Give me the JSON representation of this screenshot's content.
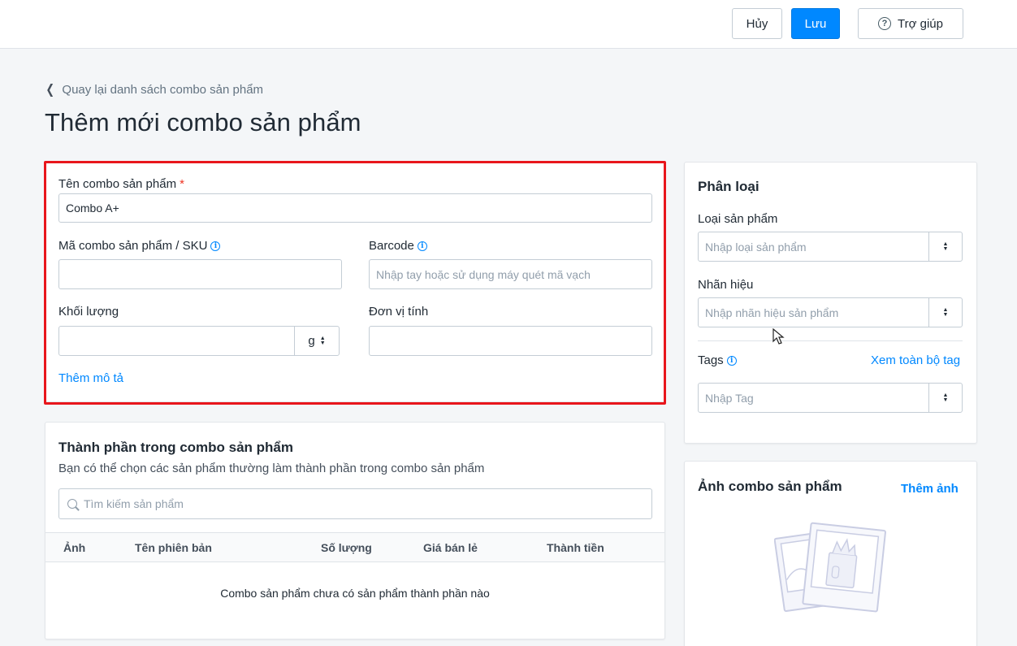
{
  "header": {
    "cancel_label": "Hủy",
    "save_label": "Lưu",
    "help_label": "Trợ giúp"
  },
  "breadcrumb": {
    "back_label": "Quay lại danh sách combo sản phẩm"
  },
  "page_title": "Thêm mới combo sản phẩm",
  "form": {
    "name_label": "Tên combo sản phẩm",
    "required_mark": "*",
    "name_value": "Combo A+",
    "sku_label": "Mã combo sản phẩm / SKU",
    "sku_value": "",
    "barcode_label": "Barcode",
    "barcode_placeholder": "Nhập tay hoặc sử dụng máy quét mã vạch",
    "weight_label": "Khối lượng",
    "weight_value": "",
    "weight_unit": "g",
    "unit_label": "Đơn vị tính",
    "unit_value": "",
    "add_description_label": "Thêm mô tả"
  },
  "components": {
    "title": "Thành phần trong combo sản phẩm",
    "subtitle": "Bạn có thể chọn các sản phẩm thường làm thành phần trong combo sản phẩm",
    "search_placeholder": "Tìm kiếm sản phẩm",
    "columns": [
      "Ảnh",
      "Tên phiên bản",
      "Số lượng",
      "Giá bán lẻ",
      "Thành tiền"
    ],
    "empty_text": "Combo sản phẩm chưa có sản phẩm thành phần nào"
  },
  "classification": {
    "title": "Phân loại",
    "product_type_label": "Loại sản phẩm",
    "product_type_placeholder": "Nhập loại sản phẩm",
    "brand_label": "Nhãn hiệu",
    "brand_placeholder": "Nhập nhãn hiệu sản phẩm",
    "tags_label": "Tags",
    "view_all_tags_label": "Xem toàn bộ tag",
    "tags_placeholder": "Nhập Tag"
  },
  "images": {
    "title": "Ảnh combo sản phẩm",
    "add_label": "Thêm ảnh"
  },
  "colors": {
    "primary": "#0088ff",
    "highlight_border": "#e8161c",
    "background": "#f4f6f8"
  }
}
